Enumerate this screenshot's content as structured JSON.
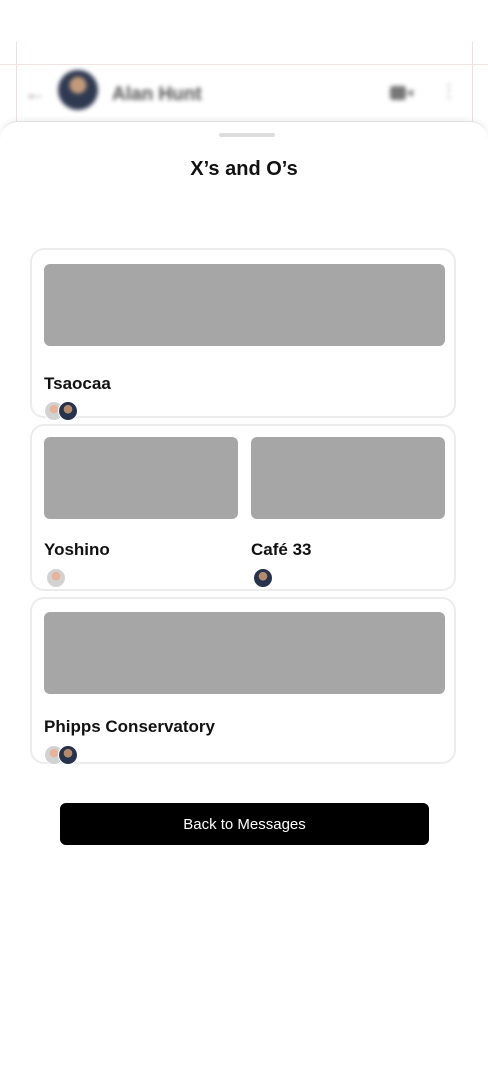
{
  "chat_header": {
    "contact_name": "Alan Hunt",
    "back_icon": "arrow-left-icon",
    "video_icon": "video-camera-icon",
    "more_icon": "more-vertical-icon"
  },
  "sheet": {
    "title": "X’s and O’s"
  },
  "cards": [
    {
      "places": [
        {
          "name": "Tsaocaa",
          "avatars": [
            "user-a",
            "user-b"
          ]
        }
      ]
    },
    {
      "places": [
        {
          "name": "Yoshino",
          "avatars": [
            "user-a"
          ]
        },
        {
          "name": "Café 33",
          "avatars": [
            "user-b"
          ]
        }
      ]
    },
    {
      "places": [
        {
          "name": "Phipps Conservatory",
          "avatars": [
            "user-a",
            "user-b"
          ]
        }
      ]
    }
  ],
  "back_button": {
    "label": "Back to Messages"
  }
}
